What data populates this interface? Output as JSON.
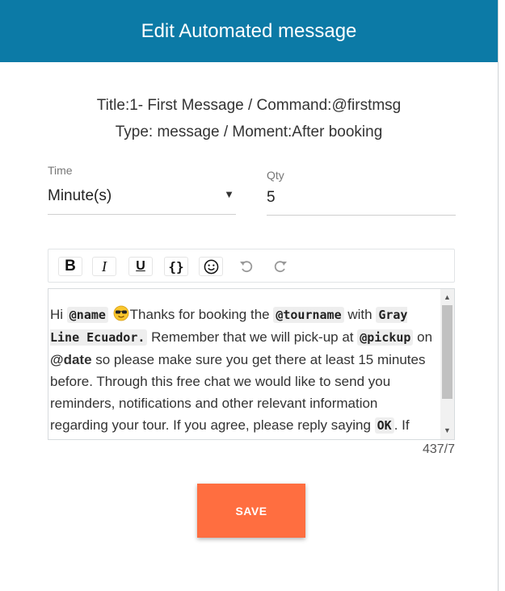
{
  "modal": {
    "title": "Edit Automated message",
    "info_line1": "Title:1- First Message / Command:@firstmsg",
    "info_line2": "Type: message / Moment:After booking"
  },
  "time_field": {
    "label": "Time",
    "value": "Minute(s)",
    "caret": "▼"
  },
  "qty_field": {
    "label": "Qty",
    "value": "5"
  },
  "toolbar": {
    "bold": "B",
    "italic": "I",
    "underline": "U",
    "code": "{}",
    "emoji": "☺",
    "undo": "↶",
    "redo": "↷"
  },
  "editor": {
    "t1": "Hi ",
    "name_token": "@name",
    "t2": "Thanks for booking the ",
    "tourname_token": "@tourname",
    "t3": " with ",
    "company_token": "Gray Line Ecuador.",
    "t4": " Remember that we will pick-up at ",
    "pickup_token": "@pickup",
    "t5": " on ",
    "date_token": "@date",
    "t6": " so please make sure you get there at least 15 minutes before. Through this free chat we would like to send you reminders, notifications and other relevant information regarding your tour. If you agree, please reply saying ",
    "ok_token": "OK",
    "t7": ". If",
    "emoji_name": "sunglasses-emoji"
  },
  "counter": "437/7",
  "save_label": "SAVE",
  "colors": {
    "header": "#0c7aa6",
    "save": "#ff6e40"
  }
}
